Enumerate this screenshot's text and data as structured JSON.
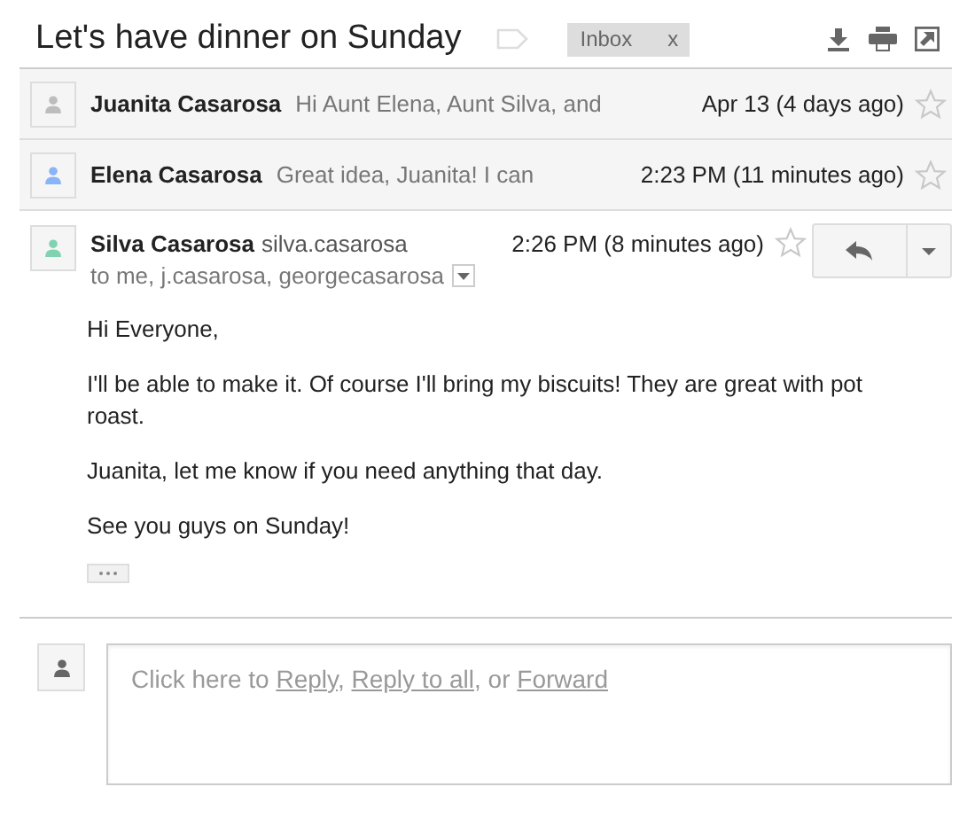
{
  "subject": "Let's have dinner on Sunday",
  "labels": [
    {
      "text": "Inbox",
      "remove": "x"
    }
  ],
  "messages": [
    {
      "kind": "collapsed",
      "sender": "Juanita Casarosa",
      "snippet": "Hi Aunt Elena, Aunt Silva, and",
      "date": "Apr 13 (4 days ago)",
      "starred": false,
      "color": "#bdbdbd"
    },
    {
      "kind": "collapsed",
      "sender": "Elena Casarosa",
      "snippet": "Great idea, Juanita! I can",
      "date": "2:23 PM (11 minutes ago)",
      "starred": false,
      "color": "#8ab4f8"
    },
    {
      "kind": "expanded",
      "sender": "Silva Casarosa",
      "email": "silva.casarosa",
      "date": "2:26 PM (8 minutes ago)",
      "starred": false,
      "color": "#7fd3b0",
      "recipients": "to me, j.casarosa, georgecasarosa",
      "body": [
        "Hi Everyone,",
        "I'll be able to make it. Of course I'll bring my biscuits! They are great with pot roast.",
        "Juanita, let me know if you need anything that day.",
        "See you guys on Sunday!"
      ]
    }
  ],
  "reply_prompt": [
    {
      "kind": "text",
      "text": "Click here to "
    },
    {
      "kind": "link",
      "text": "Reply"
    },
    {
      "kind": "text",
      "text": ", "
    },
    {
      "kind": "link",
      "text": "Reply to all"
    },
    {
      "kind": "text",
      "text": ", or "
    },
    {
      "kind": "link",
      "text": "Forward"
    }
  ]
}
